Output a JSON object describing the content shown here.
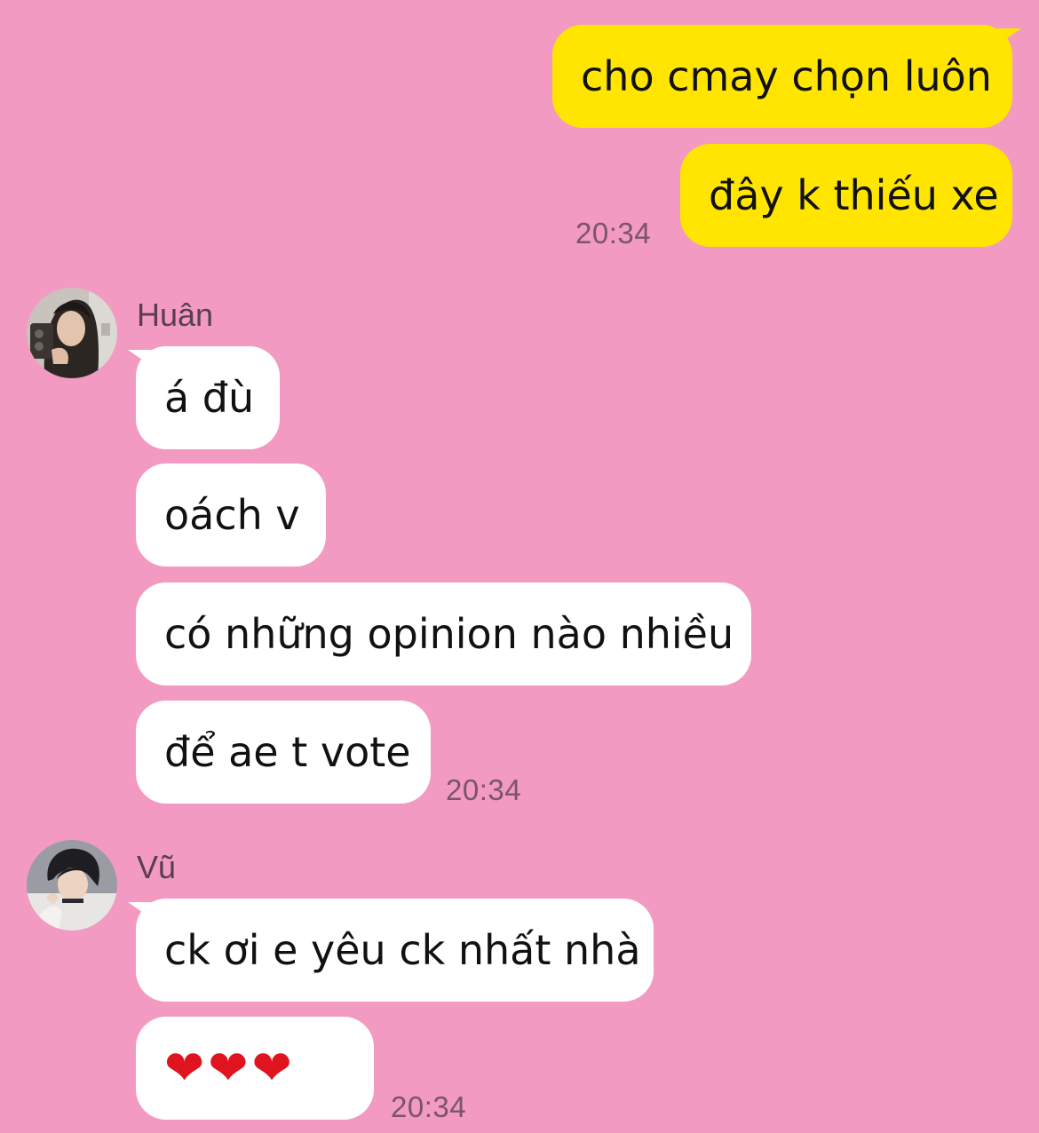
{
  "chat": {
    "outgoing": {
      "messages": [
        "cho cmay chọn luôn",
        "đây k thiếu xe"
      ],
      "time": "20:34"
    },
    "huan": {
      "name": "Huân",
      "messages": [
        "á đù",
        "oách v",
        "có những opinion nào nhiều",
        "để ae t vote"
      ],
      "time": "20:34"
    },
    "vu": {
      "name": "Vũ",
      "messages": [
        "ck ơi e yêu ck nhất nhà",
        "❤❤❤"
      ],
      "time": "20:34"
    }
  },
  "colors": {
    "background": "#f29ac1",
    "outgoing_bubble": "#ffe500",
    "incoming_bubble": "#ffffff",
    "timestamp": "#7a5568"
  },
  "icons": [
    "avatar-huan",
    "avatar-vu",
    "heart-emoji"
  ]
}
